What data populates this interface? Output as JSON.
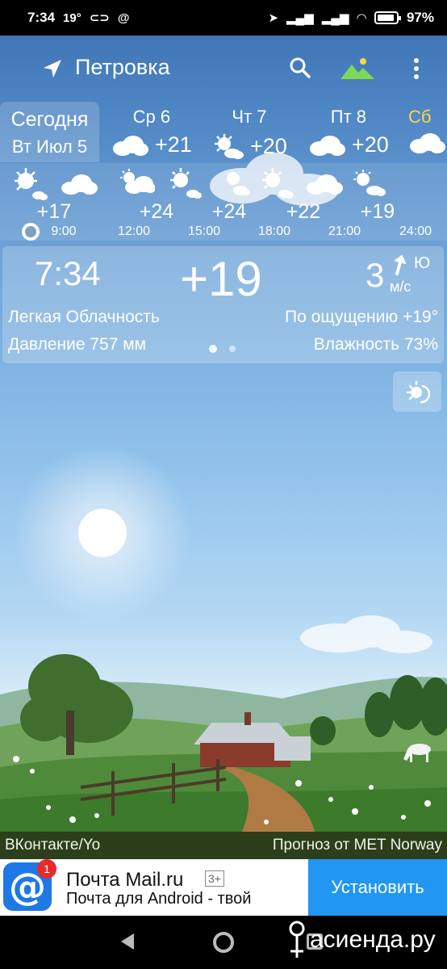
{
  "status_bar": {
    "time": "7:34",
    "temp_indicator": "19°",
    "battery": "97%"
  },
  "app_bar": {
    "location": "Петровка"
  },
  "days": {
    "today": {
      "line1": "Сегодня",
      "line2": "Вт Июл 5"
    },
    "items": [
      {
        "name": "Ср 6",
        "temp": "+21",
        "icon": "cloud-icon"
      },
      {
        "name": "Чт 7",
        "temp": "+20",
        "icon": "sun-cloud-icon"
      },
      {
        "name": "Пт 8",
        "temp": "+20",
        "icon": "cloud-icon"
      },
      {
        "name": "Сб",
        "temp": "",
        "icon": "cloud-icon"
      }
    ]
  },
  "hourly": {
    "temps": [
      "+17",
      "+24",
      "+24",
      "+22",
      "+19"
    ],
    "times": [
      "9:00",
      "12:00",
      "15:00",
      "18:00",
      "21:00",
      "24:00"
    ]
  },
  "current": {
    "time": "7:34",
    "temp": "+19",
    "wind_speed": "3",
    "wind_dir": "Ю",
    "wind_unit": "м/с",
    "condition": "Легкая Облачность",
    "feels_like": "По ощущению +19°",
    "pressure": "Давление 757 мм",
    "humidity": "Влажность 73%"
  },
  "credits": {
    "left": "ВКонтакте/Yo",
    "right": "Прогноз от MET Norway"
  },
  "ad": {
    "badge": "1",
    "title": "Почта Mail.ru",
    "rating": "3+",
    "subtitle": "Почта для Android - твой",
    "button": "Установить"
  },
  "watermark": "асиенда.ру",
  "colors": {
    "sky_top": "#3a6fb0",
    "accent_yellow": "#ffd54a",
    "install_blue": "#2196f3",
    "mail_blue": "#1e78e6"
  }
}
